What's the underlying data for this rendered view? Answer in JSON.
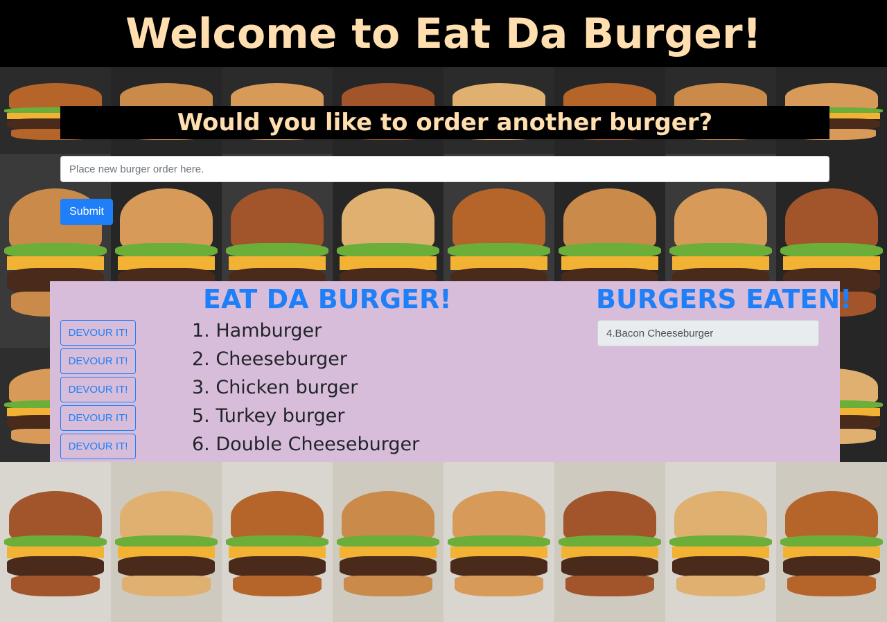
{
  "header": {
    "title": "Welcome to Eat Da Burger!"
  },
  "order": {
    "heading": "Would you like to order another burger?",
    "input_placeholder": "Place new burger order here.",
    "submit_label": "Submit"
  },
  "menu": {
    "title": "EAT DA BURGER!",
    "devour_label": "DEVOUR IT!",
    "items": [
      {
        "label": "1. Hamburger"
      },
      {
        "label": "2. Cheeseburger"
      },
      {
        "label": "3. Chicken burger"
      },
      {
        "label": "5. Turkey burger"
      },
      {
        "label": "6. Double Cheeseburger"
      }
    ]
  },
  "eaten": {
    "title": "BURGERS EATEN!",
    "items": [
      {
        "label": "4.Bacon Cheeseburger"
      }
    ]
  },
  "colors": {
    "header_bg": "#000000",
    "header_text": "#ffdeaf",
    "accent_blue": "#1e7ff8",
    "panel_bg": "#d8bddb"
  }
}
